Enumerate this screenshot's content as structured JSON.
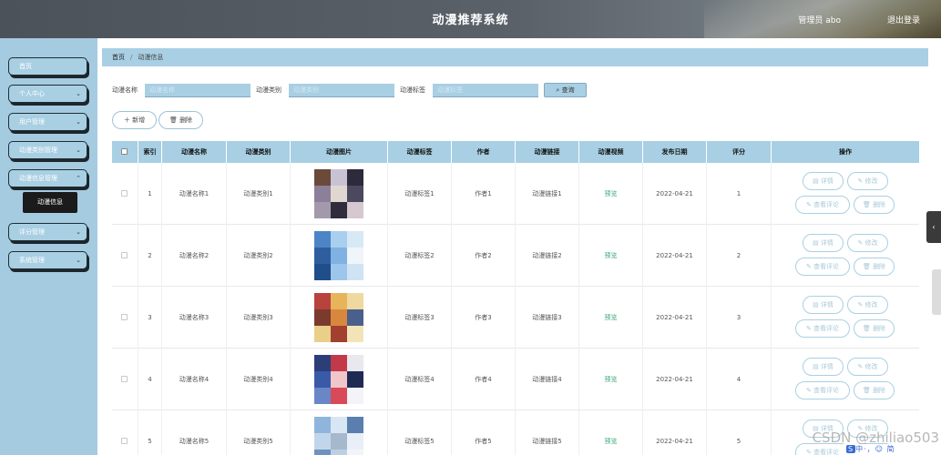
{
  "header": {
    "title": "动漫推荐系统",
    "admin": "管理员 abo",
    "logout": "退出登录"
  },
  "sidebar": {
    "items": [
      {
        "label": "首页"
      },
      {
        "label": "个人中心"
      },
      {
        "label": "用户管理"
      },
      {
        "label": "动漫类别管理"
      },
      {
        "label": "动漫信息管理"
      },
      {
        "label": "评分管理"
      },
      {
        "label": "系统管理"
      }
    ],
    "sub_item": "动漫信息"
  },
  "breadcrumb": {
    "home": "首页",
    "current": "动漫信息"
  },
  "search": {
    "name_label": "动漫名称",
    "name_placeholder": "动漫名称",
    "category_label": "动漫类别",
    "category_placeholder": "动漫类别",
    "tag_label": "动漫标签",
    "tag_placeholder": "动漫标签",
    "button": "查询"
  },
  "toolbar": {
    "add": "新增",
    "delete": "删除"
  },
  "table": {
    "headers": [
      "索引",
      "动漫名称",
      "动漫类别",
      "动漫图片",
      "动漫标签",
      "作者",
      "动漫链接",
      "动漫视频",
      "发布日期",
      "评分",
      "操作"
    ],
    "rows": [
      {
        "index": "1",
        "name": "动漫名称1",
        "category": "动漫类别1",
        "tag": "动漫标签1",
        "author": "作者1",
        "link": "动漫链接1",
        "video": "预览",
        "date": "2022-04-21",
        "score": "1"
      },
      {
        "index": "2",
        "name": "动漫名称2",
        "category": "动漫类别2",
        "tag": "动漫标签2",
        "author": "作者2",
        "link": "动漫链接2",
        "video": "预览",
        "date": "2022-04-21",
        "score": "2"
      },
      {
        "index": "3",
        "name": "动漫名称3",
        "category": "动漫类别3",
        "tag": "动漫标签3",
        "author": "作者3",
        "link": "动漫链接3",
        "video": "预览",
        "date": "2022-04-21",
        "score": "3"
      },
      {
        "index": "4",
        "name": "动漫名称4",
        "category": "动漫类别4",
        "tag": "动漫标签4",
        "author": "作者4",
        "link": "动漫链接4",
        "video": "预览",
        "date": "2022-04-21",
        "score": "4"
      },
      {
        "index": "5",
        "name": "动漫名称5",
        "category": "动漫类别5",
        "tag": "动漫标签5",
        "author": "作者5",
        "link": "动漫链接5",
        "video": "预览",
        "date": "2022-04-21",
        "score": "5"
      }
    ],
    "actions": {
      "detail": "详情",
      "edit": "修改",
      "view_rating": "查看评论",
      "delete": "删除"
    }
  },
  "watermark": "CSDN @zhiliao503",
  "ime": "中·，☺ 简",
  "colors": {
    "accent": "#a8cfe3",
    "sidebar": "#a5cbe0",
    "link": "#3aa676"
  }
}
